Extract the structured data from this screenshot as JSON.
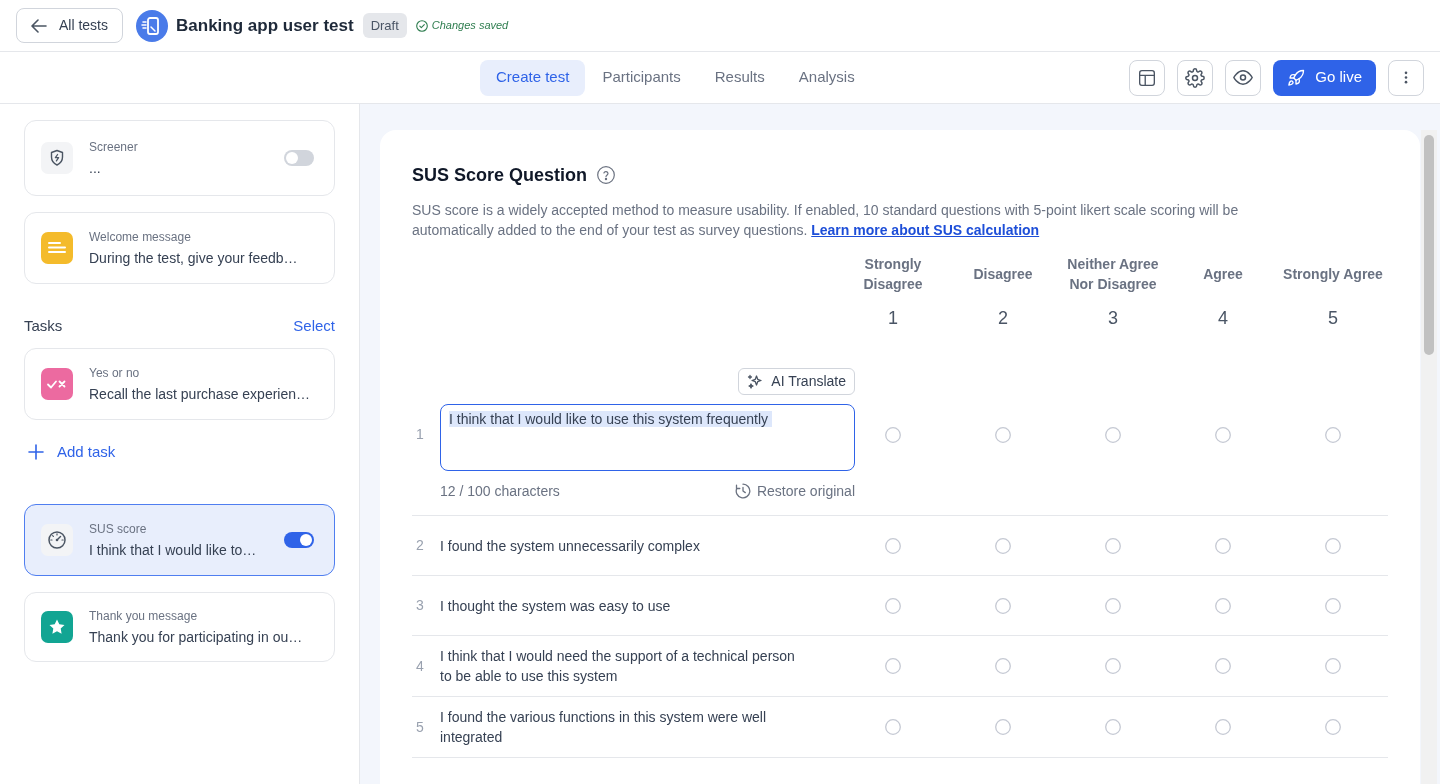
{
  "header": {
    "back_button": "All tests",
    "title": "Banking app user test",
    "status_badge": "Draft",
    "save_status": "Changes saved"
  },
  "tabs": [
    {
      "label": "Create test",
      "selected": true
    },
    {
      "label": "Participants",
      "selected": false
    },
    {
      "label": "Results",
      "selected": false
    },
    {
      "label": "Analysis",
      "selected": false
    }
  ],
  "toolbar": {
    "go_live_button": "Go live"
  },
  "sidebar": {
    "intro_items": [
      {
        "kind": "screener",
        "label": "Screener",
        "text": "...",
        "selected": false,
        "toggle": {
          "on": false
        }
      },
      {
        "kind": "welcome",
        "label": "Welcome message",
        "text": "During the test, give your feedb…",
        "selected": false
      }
    ],
    "tasks": {
      "heading": "Tasks",
      "action": "Select",
      "items": [
        {
          "kind": "yes_no",
          "label": "Yes or no",
          "text": "Recall the last purchase experien…",
          "selected": false
        }
      ],
      "add_button": "Add task"
    },
    "closing_items": [
      {
        "kind": "sus",
        "label": "SUS score",
        "text": "I think that I would like to…",
        "selected": true,
        "toggle": {
          "on": true
        }
      },
      {
        "kind": "thank_you",
        "label": "Thank you message",
        "text": "Thank you for participating in ou…",
        "selected": false
      }
    ]
  },
  "sus_question": {
    "title": "SUS Score Question",
    "description": "SUS score is a widely accepted method to measure usability. If enabled, 10 standard questions with 5-point likert scale scoring will be automatically added to the end of your test as survey questions.",
    "learn_more_link": "Learn more about SUS calculation",
    "scale": [
      {
        "label": "Strongly Disagree",
        "value": "1"
      },
      {
        "label": "Disagree",
        "value": "2"
      },
      {
        "label": "Neither Agree Nor Disagree",
        "value": "3"
      },
      {
        "label": "Agree",
        "value": "4"
      },
      {
        "label": "Strongly Agree",
        "value": "5"
      }
    ],
    "questions": [
      {
        "number": "1",
        "text": "I think that I would like to use this system frequently",
        "editing": true,
        "ai_translate_button": "AI Translate",
        "character_count": "12 / 100 characters",
        "restore_button": "Restore original",
        "ratings": [
          {
            "selected": false
          },
          {
            "selected": false
          },
          {
            "selected": false
          },
          {
            "selected": false
          },
          {
            "selected": false
          }
        ]
      },
      {
        "number": "2",
        "text": "I found the system unnecessarily complex",
        "editing": false,
        "ratings": [
          {
            "selected": false
          },
          {
            "selected": false
          },
          {
            "selected": false
          },
          {
            "selected": false
          },
          {
            "selected": false
          }
        ]
      },
      {
        "number": "3",
        "text": "I thought the system was easy to use",
        "editing": false,
        "ratings": [
          {
            "selected": false
          },
          {
            "selected": false
          },
          {
            "selected": false
          },
          {
            "selected": false
          },
          {
            "selected": false
          }
        ]
      },
      {
        "number": "4",
        "text": "I think that I would need the support of a technical person to be able to use this system",
        "editing": false,
        "ratings": [
          {
            "selected": false
          },
          {
            "selected": false
          },
          {
            "selected": false
          },
          {
            "selected": false
          },
          {
            "selected": false
          }
        ]
      },
      {
        "number": "5",
        "text": "I found the various functions in this system were well integrated",
        "editing": false,
        "ratings": [
          {
            "selected": false
          },
          {
            "selected": false
          },
          {
            "selected": false
          },
          {
            "selected": false
          },
          {
            "selected": false
          }
        ]
      }
    ]
  }
}
